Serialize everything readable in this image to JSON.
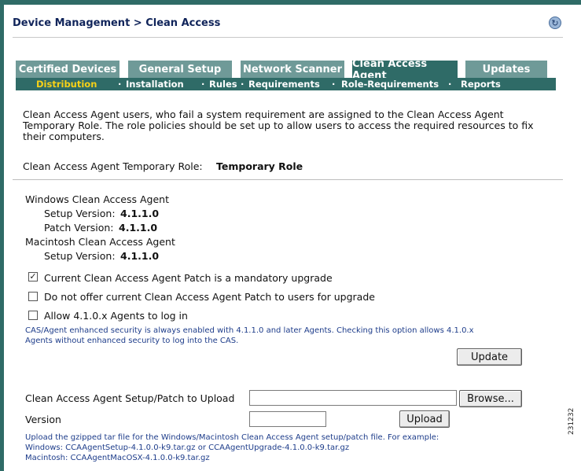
{
  "header": {
    "title": "Device Management > Clean Access",
    "refresh_icon": "refresh-icon"
  },
  "tabs": [
    {
      "label": "Certified Devices",
      "active": false
    },
    {
      "label": "General Setup",
      "active": false
    },
    {
      "label": "Network Scanner",
      "active": false
    },
    {
      "label": "Clean Access Agent",
      "active": true
    },
    {
      "label": "Updates",
      "active": false
    }
  ],
  "subnav": {
    "items": [
      "Distribution",
      "Installation",
      "Rules",
      "Requirements",
      "Role-Requirements",
      "Reports"
    ],
    "separator": "·",
    "selected": "Distribution"
  },
  "intro": {
    "line1": "Clean Access Agent users, who fail a system requirement are assigned to the Clean Access Agent",
    "line2": "Temporary Role. The role policies should be set up to allow users to access the required resources to fix",
    "line3": "their computers."
  },
  "temp_role": {
    "label": "Clean Access Agent Temporary Role:",
    "value": "Temporary Role"
  },
  "versions": {
    "windows_heading": "Windows Clean Access Agent",
    "setup_label": "Setup Version:",
    "windows_setup": "4.1.1.0",
    "patch_label": "Patch Version:",
    "windows_patch": "4.1.1.0",
    "mac_heading": "Macintosh Clean Access Agent",
    "mac_setup": "4.1.1.0"
  },
  "options": {
    "mandatory_label": "Current Clean Access Agent Patch is a mandatory upgrade",
    "mandatory_checked": true,
    "no_offer_label": "Do not offer current Clean Access Agent Patch to users for upgrade",
    "no_offer_checked": false,
    "allow_label": "Allow 4.1.0.x Agents to log in",
    "allow_checked": false,
    "note1": "CAS/Agent enhanced security is always enabled with 4.1.1.0 and later Agents. Checking this option allows 4.1.0.x",
    "note2": "Agents without enhanced security to log into the CAS."
  },
  "buttons": {
    "update": "Update",
    "browse": "Browse...",
    "upload": "Upload"
  },
  "upload": {
    "file_label": "Clean Access Agent Setup/Patch to Upload",
    "file_value": "",
    "version_label": "Version",
    "version_value": "",
    "help1": "Upload the gzipped tar file for the Windows/Macintosh Clean Access Agent setup/patch file. For example:",
    "help2": "Windows: CCAAgentSetup-4.1.0.0-k9.tar.gz or CCAAgentUpgrade-4.1.0.0-k9.tar.gz",
    "help3": "Macintosh: CCAAgentMacOSX-4.1.0.0-k9.tar.gz"
  },
  "figure_id": "231232",
  "colors": {
    "accent": "#2f6b67",
    "tab_inactive": "#6f9a98",
    "selected_subnav": "#f7d117",
    "title": "#10245a",
    "note": "#1d3c8a"
  }
}
